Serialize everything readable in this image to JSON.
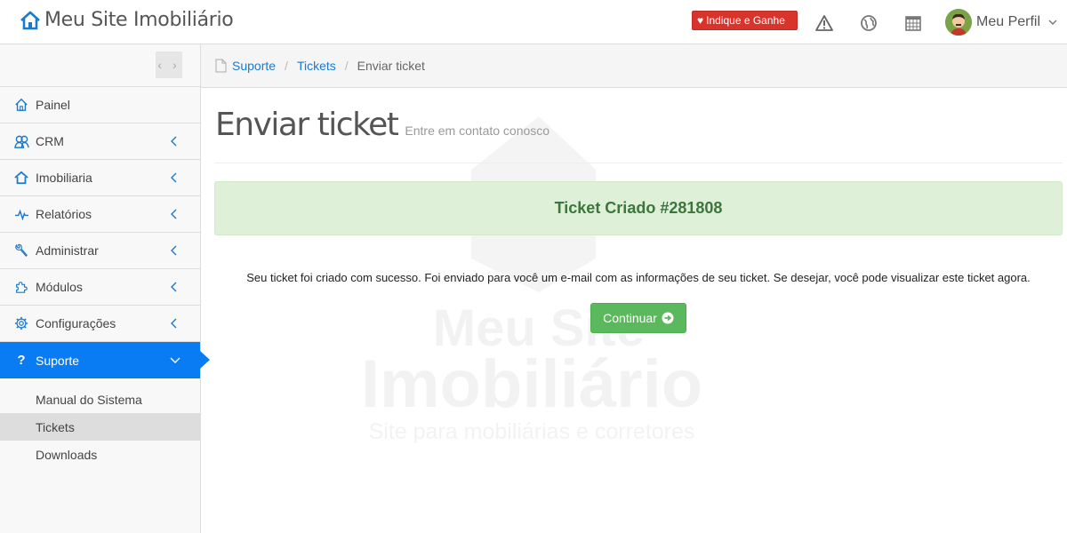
{
  "header": {
    "brand": "Meu Site Imobiliário",
    "refer_label": "Indique e Ganhe",
    "profile_label": "Meu Perfil",
    "icons": [
      "warning-icon",
      "globe-icon",
      "calendar-icon"
    ]
  },
  "sidebar": {
    "toggle_label": "‹ ›",
    "items": [
      {
        "label": "Painel",
        "icon": "home-icon"
      },
      {
        "label": "CRM",
        "icon": "users-icon"
      },
      {
        "label": "Imobiliaria",
        "icon": "house-icon"
      },
      {
        "label": "Relatórios",
        "icon": "pulse-icon"
      },
      {
        "label": "Administrar",
        "icon": "wrench-icon"
      },
      {
        "label": "Módulos",
        "icon": "puzzle-icon"
      },
      {
        "label": "Configurações",
        "icon": "gear-icon"
      },
      {
        "label": "Suporte",
        "icon": "question-icon"
      }
    ],
    "subitems": [
      {
        "label": "Manual do Sistema"
      },
      {
        "label": "Tickets"
      },
      {
        "label": "Downloads"
      }
    ]
  },
  "breadcrumb": {
    "items": [
      "Suporte",
      "Tickets"
    ],
    "current": "Enviar ticket"
  },
  "main": {
    "title": "Enviar ticket",
    "subtitle": "Entre em contato conosco",
    "alert": "Ticket Criado #281808",
    "message": "Seu ticket foi criado com sucesso. Foi enviado para você um e-mail com as informações de seu ticket. Se desejar, você pode visualizar este ticket agora.",
    "continue_label": "Continuar",
    "watermark": {
      "line1": "Meu Site",
      "line2": "Imobiliário",
      "line3": "Site para mobiliárias e corretores"
    }
  },
  "colors": {
    "accent": "#0a7cf3",
    "refer": "#d9342b",
    "success_bg": "#dff0d8",
    "success_text": "#3c763d",
    "button_green": "#5cb85c"
  }
}
